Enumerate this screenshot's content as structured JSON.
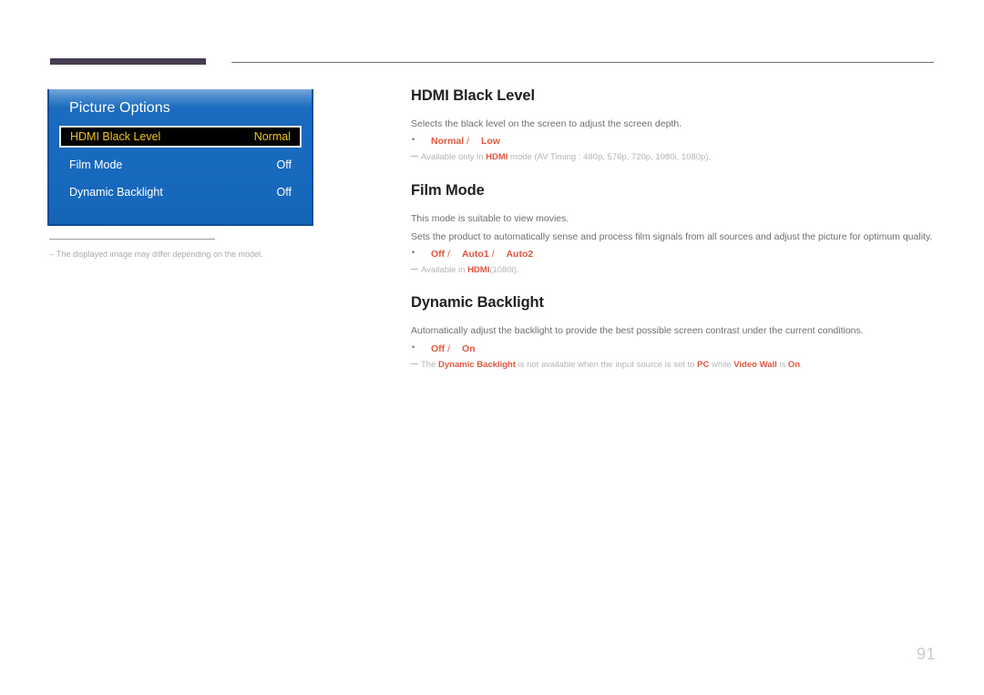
{
  "header": {
    "thick_bar_color": "#463c52",
    "thin_rule_color": "#6e6e72"
  },
  "osd": {
    "title": "Picture Options",
    "panel_color": "#1b6cc0",
    "highlight_bg": "#000000",
    "highlight_text_color": "#f0c419",
    "rows": [
      {
        "label": "HDMI Black Level",
        "value": "Normal",
        "selected": true
      },
      {
        "label": "Film Mode",
        "value": "Off",
        "selected": false
      },
      {
        "label": "Dynamic Backlight",
        "value": "Off",
        "selected": false
      }
    ],
    "note": "The displayed image may differ depending on the model."
  },
  "accent_color": "#e0563f",
  "sections": [
    {
      "title": "HDMI Black Level",
      "body": [
        "Selects the black level on the screen to adjust the screen depth."
      ],
      "options": [
        "Normal",
        "Low"
      ],
      "note_html": "Available only in <b>HDMI</b> mode (AV Timing : 480p, 576p, 720p, 1080i, 1080p)."
    },
    {
      "title": "Film Mode",
      "body": [
        "This mode is suitable to view movies.",
        "Sets the product to automatically sense and process film signals from all sources and adjust the picture for optimum quality."
      ],
      "options": [
        "Off",
        "Auto1",
        "Auto2"
      ],
      "note_html": "Available in <b>HDMI</b>(1080i)."
    },
    {
      "title": "Dynamic Backlight",
      "body": [
        "Automatically adjust the backlight to provide the best possible screen contrast under the current conditions."
      ],
      "options": [
        "Off",
        "On"
      ],
      "note_html": "The <b>Dynamic Backlight</b> is not available when the input source is set to <b>PC</b> while <b>Video Wall</b> is <b>On</b>."
    }
  ],
  "page_number": "91"
}
